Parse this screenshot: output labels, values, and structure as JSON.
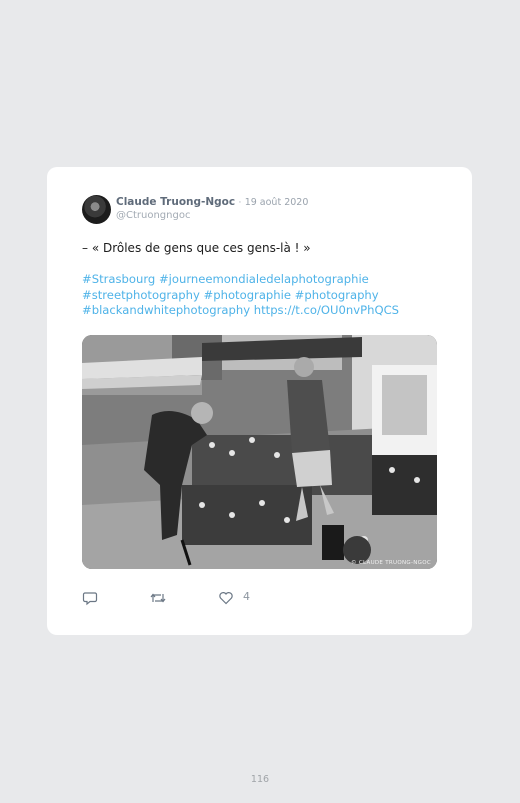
{
  "tweet": {
    "author_name": "Claude Truong-Ngoc",
    "separator": "·",
    "date": "19 août 2020",
    "handle": "@Ctruongngoc",
    "text": "– « Drôles de gens que ces gens-là ! »",
    "hashtag_lines": [
      "#Strasbourg #journeemondialedelaphotographie",
      "#streetphotography #photographie #photography",
      "#blackandwhitephotography https://t.co/OU0nvPhQCS"
    ],
    "photo_watermark": "© CLAUDE TRUONG-NGOC",
    "like_count": "4",
    "link_color": "#4fb3e8"
  },
  "actions": {
    "reply_icon": "reply-icon",
    "retweet_icon": "retweet-icon",
    "like_icon": "heart-icon"
  },
  "page": {
    "number": "116"
  }
}
